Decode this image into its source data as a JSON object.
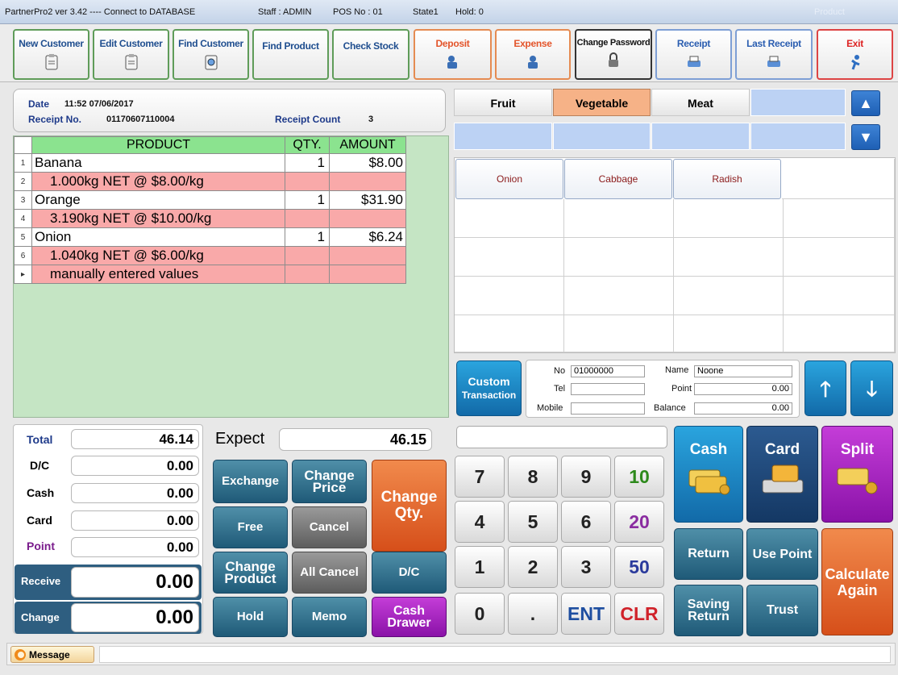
{
  "titlebar": {
    "app": "PartnerPro2  ver 3.42  ----  Connect to DATABASE",
    "staff": "Staff : ADMIN",
    "pos": "POS No : 01",
    "state": "State1",
    "hold": "Hold: 0",
    "right": "Product"
  },
  "toolbar": {
    "new_customer": "New Customer",
    "edit_customer": "Edit Customer",
    "find_customer": "Find Customer",
    "find_product": "Find Product",
    "check_stock": "Check Stock",
    "deposit": "Deposit",
    "expense": "Expense",
    "change_password": "Change Password",
    "receipt": "Receipt",
    "last_receipt": "Last Receipt",
    "exit": "Exit"
  },
  "info": {
    "date_label": "Date",
    "date_value": "11:52 07/06/2017",
    "receipt_label": "Receipt No.",
    "receipt_value": "01170607110004",
    "count_label": "Receipt Count",
    "count_value": "3"
  },
  "grid": {
    "headers": {
      "product": "PRODUCT",
      "qty": "QTY.",
      "amount": "AMOUNT"
    },
    "rows": [
      {
        "n": "1",
        "product": "Banana",
        "qty": "1",
        "amount": "$8.00"
      },
      {
        "n": "2",
        "product": "1.000kg NET @ $8.00/kg",
        "qty": "",
        "amount": ""
      },
      {
        "n": "3",
        "product": "Orange",
        "qty": "1",
        "amount": "$31.90"
      },
      {
        "n": "4",
        "product": "3.190kg NET @ $10.00/kg",
        "qty": "",
        "amount": ""
      },
      {
        "n": "5",
        "product": "Onion",
        "qty": "1",
        "amount": "$6.24"
      },
      {
        "n": "6",
        "product": "1.040kg NET @ $6.00/kg",
        "qty": "",
        "amount": ""
      },
      {
        "n": "▸",
        "product": "manually entered values",
        "qty": "",
        "amount": ""
      }
    ]
  },
  "categories": {
    "fruit": "Fruit",
    "vegetable": "Vegetable",
    "meat": "Meat"
  },
  "products": {
    "p1": "Onion",
    "p2": "Cabbage",
    "p3": "Radish"
  },
  "customer": {
    "custom_btn": "Custom",
    "custom_btn2": "Transaction",
    "no_label": "No",
    "no_value": "01000000",
    "name_label": "Name",
    "name_value": "Noone",
    "tel_label": "Tel",
    "tel_value": "",
    "point_label": "Point",
    "point_value": "0.00",
    "mobile_label": "Mobile",
    "mobile_value": "",
    "balance_label": "Balance",
    "balance_value": "0.00"
  },
  "totals": {
    "total_label": "Total",
    "total_value": "46.14",
    "dc_label": "D/C",
    "dc_value": "0.00",
    "cash_label": "Cash",
    "cash_value": "0.00",
    "card_label": "Card",
    "card_value": "0.00",
    "point_label": "Point",
    "point_value": "0.00",
    "receive_label": "Receive",
    "receive_value": "0.00",
    "change_label": "Change",
    "change_value": "0.00",
    "expect_label": "Expect",
    "expect_value": "46.15"
  },
  "actions": {
    "exchange": "Exchange",
    "change_price": "Change Price",
    "change_qty": "Change Qty.",
    "free": "Free",
    "cancel": "Cancel",
    "change_product": "Change Product",
    "all_cancel": "All Cancel",
    "dc": "D/C",
    "hold": "Hold",
    "memo": "Memo",
    "cash_drawer": "Cash Drawer"
  },
  "keypad": {
    "k7": "7",
    "k8": "8",
    "k9": "9",
    "k10": "10",
    "k4": "4",
    "k5": "5",
    "k6": "6",
    "k20": "20",
    "k1": "1",
    "k2": "2",
    "k3": "3",
    "k50": "50",
    "k0": "0",
    "kdot": ".",
    "kent": "ENT",
    "kclr": "CLR"
  },
  "payment": {
    "cash": "Cash",
    "card": "Card",
    "split": "Split",
    "return": "Return",
    "use_point": "Use Point",
    "calculate": "Calculate Again",
    "saving_return": "Saving Return",
    "trust": "Trust"
  },
  "message": {
    "label": "Message"
  }
}
